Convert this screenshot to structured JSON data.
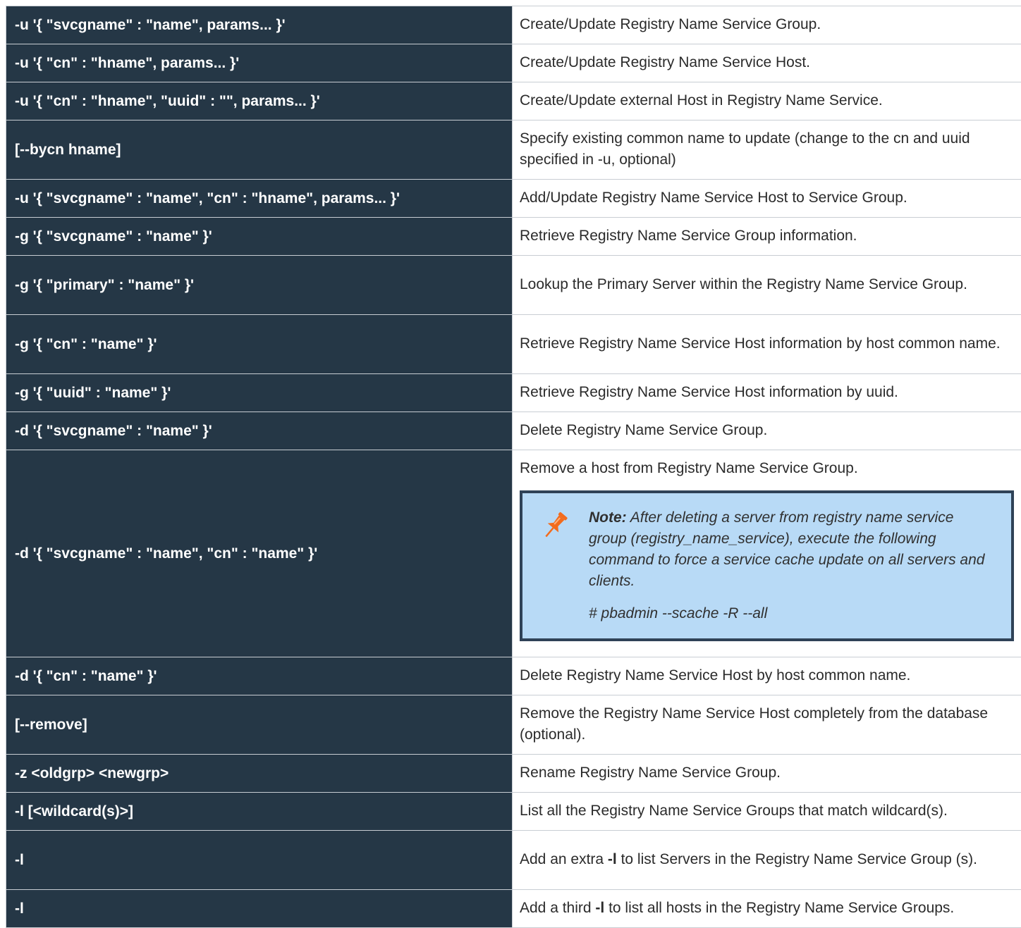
{
  "rows": [
    {
      "option": "-u '{ \"svcgname\" : \"name\", params... }'",
      "desc": "Create/Update Registry Name Service Group."
    },
    {
      "option": "-u '{ \"cn\" : \"hname\", params... }'",
      "desc": "Create/Update Registry Name Service Host."
    },
    {
      "option": "-u '{ \"cn\" : \"hname\", \"uuid\" : \"\", params... }'",
      "desc": "Create/Update external Host in Registry Name Service."
    },
    {
      "option": "[--bycn hname]",
      "desc": "Specify existing common name to update (change to the cn and uuid specified in -u, optional)"
    },
    {
      "option": "-u '{ \"svcgname\" : \"name\", \"cn\" : \"hname\", params... }'",
      "desc": "Add/Update Registry Name Service Host to Service Group."
    },
    {
      "option": "-g '{ \"svcgname\" : \"name\" }'",
      "desc": "Retrieve Registry Name Service Group information."
    },
    {
      "option": "-g '{ \"primary\" : \"name\" }'",
      "desc": "Lookup the Primary Server within the Registry Name Service Group."
    },
    {
      "option": "-g '{ \"cn\" : \"name\" }'",
      "desc": "Retrieve Registry Name Service Host information by host common name."
    },
    {
      "option": "-g '{ \"uuid\" : \"name\" }'",
      "desc": "Retrieve Registry Name Service Host information by uuid."
    },
    {
      "option": "-d '{ \"svcgname\" : \"name\" }'",
      "desc": "Delete Registry Name Service Group."
    },
    {
      "option": "-d '{ \"svcgname\" : \"name\", \"cn\" : \"name\" }'",
      "desc": "Remove a host from Registry Name Service Group."
    },
    {
      "option": "-d '{ \"cn\" : \"name\" }'",
      "desc": "Delete Registry Name Service Host by host common name."
    },
    {
      "option": "[--remove]",
      "desc": "Remove the Registry Name Service Host completely from the database (optional)."
    },
    {
      "option": "-z <oldgrp> <newgrp>",
      "desc": "Rename Registry Name Service Group."
    },
    {
      "option": "-l [<wildcard(s)>]",
      "desc": "List all the Registry Name Service Groups that match wildcard(s)."
    },
    {
      "option": "-l",
      "desc_pre": "Add an extra ",
      "desc_bold": "-l",
      "desc_post": " to list Servers in the Registry Name Service Group (s)."
    },
    {
      "option": "-l",
      "desc_pre": "Add a third ",
      "desc_bold": "-l",
      "desc_post": " to list all hosts in the Registry Name Service Groups."
    }
  ],
  "note": {
    "label": "Note:",
    "text": " After deleting a server from registry name service group (registry_name_service), execute the following command to force a service cache update on all servers and clients.",
    "command": "# pbadmin --scache -R --all",
    "icon": "pushpin-icon",
    "colors": {
      "background": "#b8daf6",
      "border": "#2f4257",
      "pin": "#f26b1d"
    }
  },
  "colors": {
    "option_bg": "#253746",
    "option_text": "#ffffff",
    "desc_text": "#2b2b2b"
  }
}
